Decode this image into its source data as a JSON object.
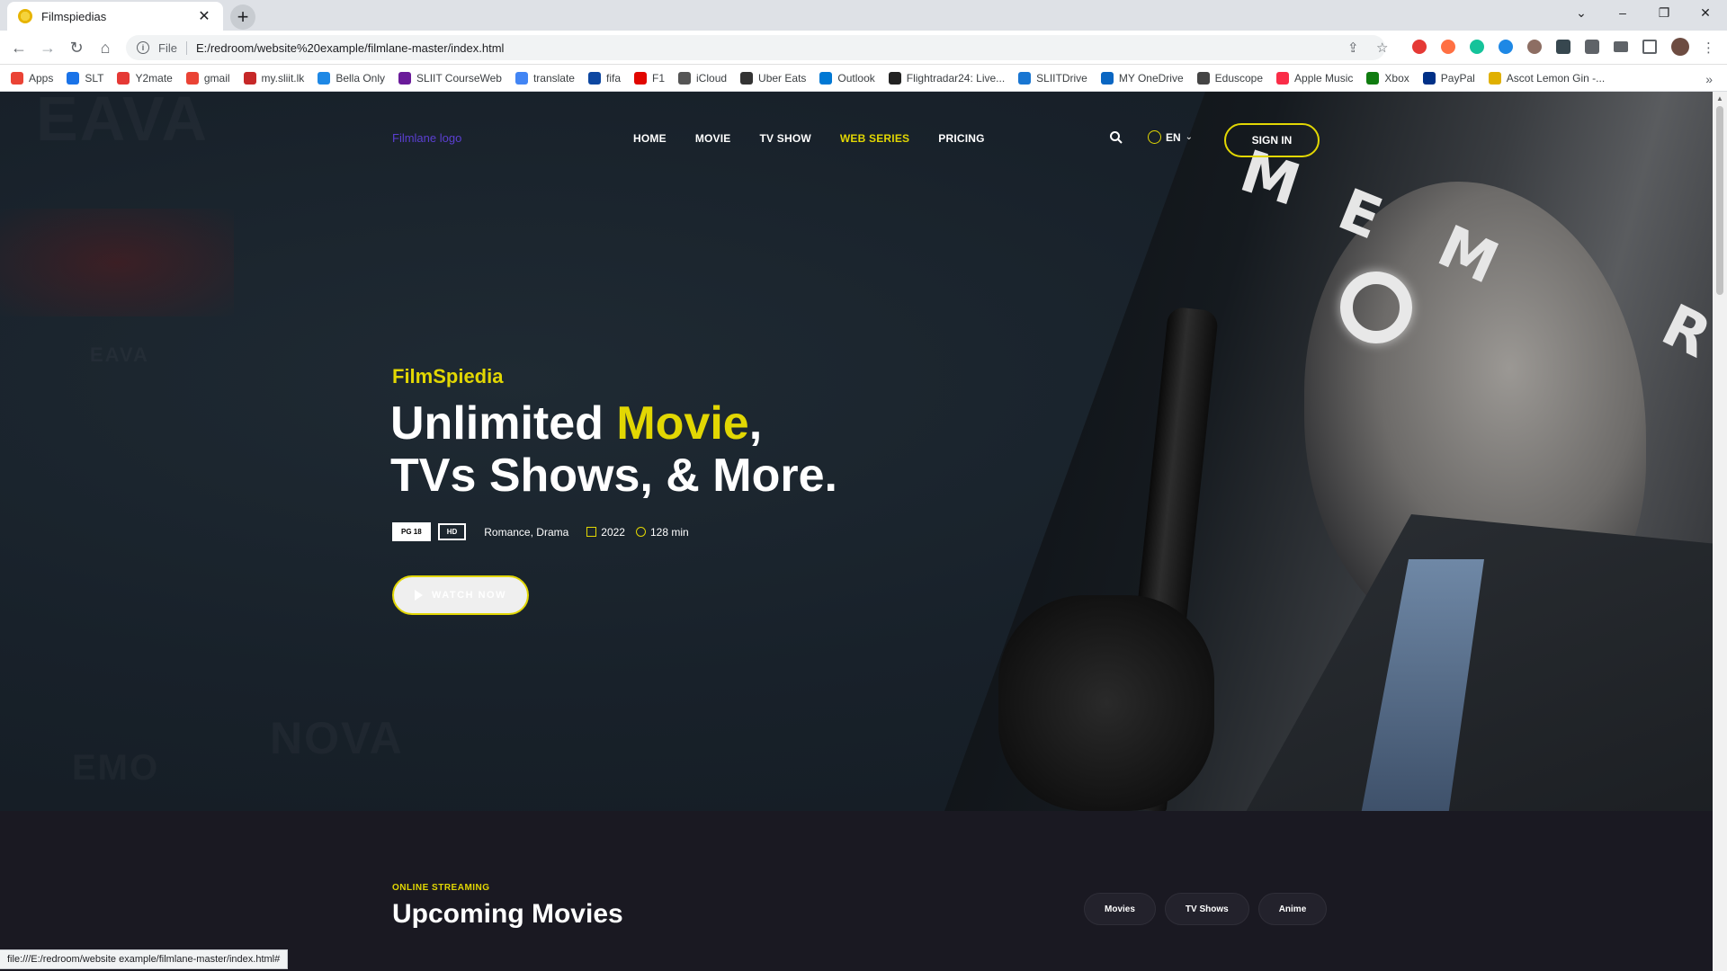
{
  "browser": {
    "tab_title": "Filmspiedias",
    "tab_close": "✕",
    "new_tab": "+",
    "omnibox_scheme": "File",
    "url": "E:/redroom/website%20example/filmlane-master/index.html",
    "window_controls": [
      "⌄",
      "–",
      "❐",
      "✕"
    ],
    "bookmarks": [
      {
        "label": "Apps",
        "color": "#ea4335"
      },
      {
        "label": "SLT",
        "color": "#1a73e8"
      },
      {
        "label": "Y2mate",
        "color": "#e53935"
      },
      {
        "label": "gmail",
        "color": "#ea4335"
      },
      {
        "label": "my.sliit.lk",
        "color": "#c62828"
      },
      {
        "label": "Bella Only",
        "color": "#1e88e5"
      },
      {
        "label": "SLIIT CourseWeb",
        "color": "#6a1b9a"
      },
      {
        "label": "translate",
        "color": "#4285f4"
      },
      {
        "label": "fifa",
        "color": "#0d47a1"
      },
      {
        "label": "F1",
        "color": "#e10600"
      },
      {
        "label": "iCloud",
        "color": "#555555"
      },
      {
        "label": "Uber Eats",
        "color": "#333333"
      },
      {
        "label": "Outlook",
        "color": "#0078d4"
      },
      {
        "label": "Flightradar24: Live...",
        "color": "#222222"
      },
      {
        "label": "SLIITDrive",
        "color": "#1976d2"
      },
      {
        "label": "MY OneDrive",
        "color": "#0a66c2"
      },
      {
        "label": "Eduscope",
        "color": "#444444"
      },
      {
        "label": "Apple Music",
        "color": "#fa2d48"
      },
      {
        "label": "Xbox",
        "color": "#107c10"
      },
      {
        "label": "PayPal",
        "color": "#003087"
      },
      {
        "label": "Ascot Lemon Gin -...",
        "color": "#e0b000"
      }
    ],
    "bookmarks_more": "»",
    "status_url": "file:///E:/redroom/website example/filmlane-master/index.html#"
  },
  "header": {
    "logo_alt": "Filmlane logo",
    "nav": [
      "HOME",
      "MOVIE",
      "TV SHOW",
      "WEB SERIES",
      "PRICING"
    ],
    "active_nav": "WEB SERIES",
    "lang": "EN",
    "sign_in": "SIGN IN"
  },
  "hero": {
    "subtitle": "FilmSpiedia",
    "title_part1": "Unlimited ",
    "title_highlight": "Movie",
    "title_part2": ",",
    "title_line2": "TVs Shows, & More.",
    "badge_rating": "PG 18",
    "badge_quality": "HD",
    "genres": "Romance,  Drama",
    "year": "2022",
    "duration": "128 min",
    "watch_label": "WATCH NOW",
    "poster_letters": [
      "M",
      "E",
      "M",
      "R"
    ]
  },
  "upcoming": {
    "kicker": "ONLINE STREAMING",
    "title": "Upcoming Movies",
    "filters": [
      "Movies",
      "TV Shows",
      "Anime"
    ]
  },
  "colors": {
    "accent": "#e2d703",
    "hero_bg": "#18212a",
    "section_bg": "#1a1922"
  }
}
